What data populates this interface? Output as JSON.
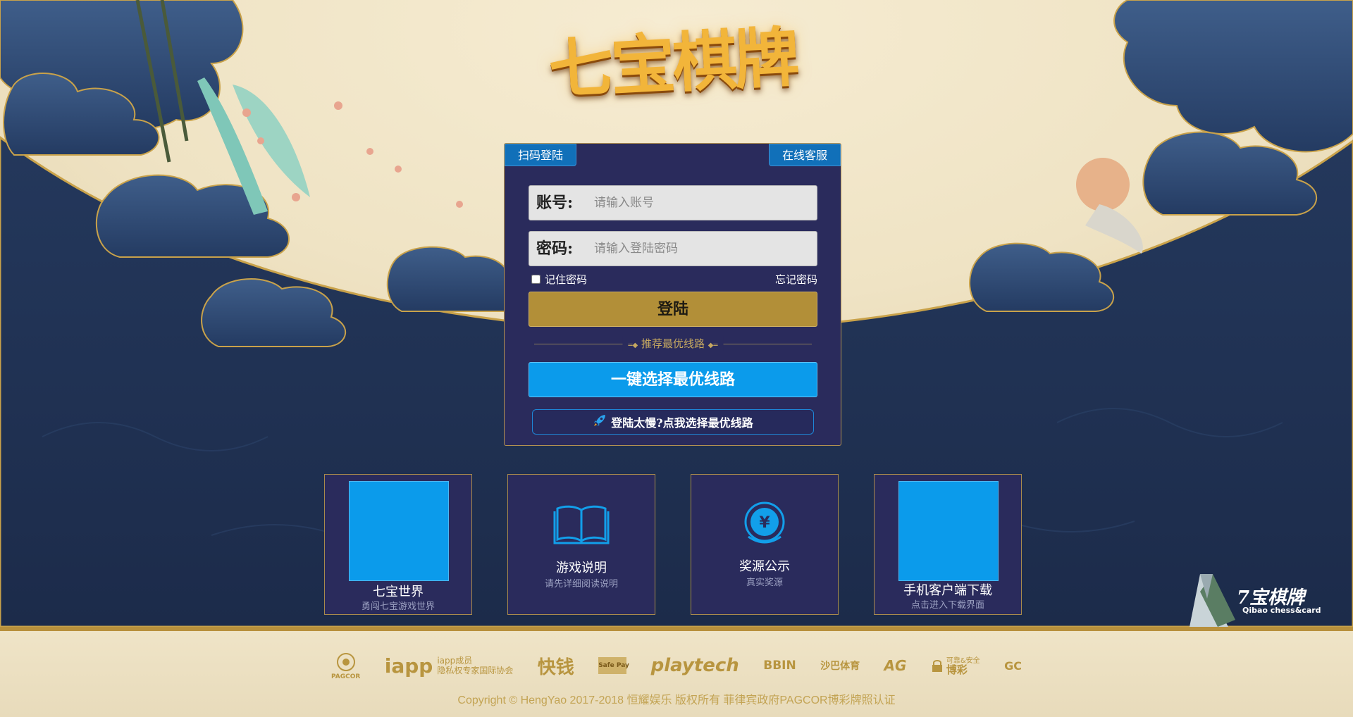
{
  "logo": {
    "text": "七宝棋牌"
  },
  "login": {
    "scan_tab": "扫码登陆",
    "service_tab": "在线客服",
    "account_label": "账号:",
    "account_placeholder": "请输入账号",
    "password_label": "密码:",
    "password_placeholder": "请输入登陆密码",
    "remember_label": "记住密码",
    "forgot_label": "忘记密码",
    "login_button": "登陆",
    "route_divider": "推荐最优线路",
    "best_route_button": "一键选择最优线路",
    "slow_login_button": "登陆太慢?点我选择最优线路"
  },
  "cards": [
    {
      "title": "七宝世界",
      "subtitle": "勇闯七宝游戏世界",
      "icon": "qr-code-placeholder"
    },
    {
      "title": "游戏说明",
      "subtitle": "请先详细阅读说明",
      "icon": "book-icon"
    },
    {
      "title": "奖源公示",
      "subtitle": "真实奖源",
      "icon": "yen-coin-icon"
    },
    {
      "title": "手机客户端下载",
      "subtitle": "点击进入下载界面",
      "icon": "qr-code-placeholder"
    }
  ],
  "brand": {
    "name": "7宝棋牌",
    "sub": "Qibao chess&card"
  },
  "partners": [
    {
      "name": "PAGCOR"
    },
    {
      "name": "iapp",
      "desc_line1": "iapp成员",
      "desc_line2": "隐私权专家国际协会"
    },
    {
      "name": "快钱"
    },
    {
      "name": "Safe Pay"
    },
    {
      "name": "playtech"
    },
    {
      "name": "BBIN"
    },
    {
      "name": "沙巴体育"
    },
    {
      "name": "AG"
    },
    {
      "name": "博彩",
      "desc_line1": "可靠&安全"
    },
    {
      "name": "GC"
    }
  ],
  "copyright": "Copyright © HengYao 2017-2018 恒耀娱乐 版权所有 菲律宾政府PAGCOR博彩牌照认证",
  "colors": {
    "panel_bg": "#2a2b5c",
    "gold": "#b28f38",
    "accent_blue": "#0b9beb",
    "tab_blue": "#1170b9",
    "navy_bg": "#1f2f4f"
  }
}
